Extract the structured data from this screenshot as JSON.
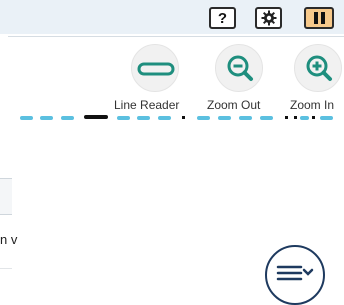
{
  "header": {
    "help_label": "?",
    "settings_icon": "gear-icon",
    "pause_icon": "pause-icon"
  },
  "tools": {
    "line_reader_label": "Line Reader",
    "zoom_out_label": "Zoom Out",
    "zoom_in_label": "Zoom In"
  },
  "content": {
    "cut_text": "n v"
  },
  "menu": {
    "icon": "hamburger-chevron-icon"
  },
  "colors": {
    "accent": "#1e8e7e",
    "pause_bg": "#f7c98b",
    "nav_dot": "#5bc0e0",
    "nav_current": "#111111"
  }
}
